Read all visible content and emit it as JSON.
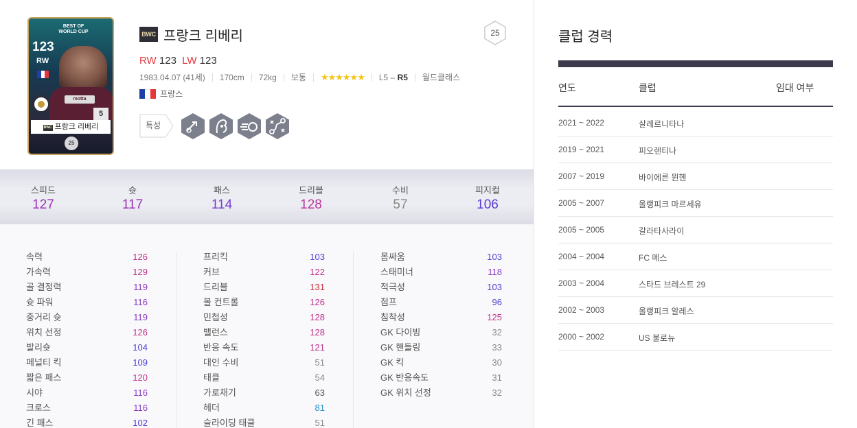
{
  "player": {
    "card": {
      "edition_label": "BEST OF WORLD CUP",
      "ovr": "123",
      "pos": "RW",
      "shirt_text": "motta",
      "reinforce": "5",
      "name": "프랑크 리베리",
      "name_badge": "BWC",
      "level": "25"
    },
    "season_badge": "BWC",
    "name": "프랑크 리베리",
    "level": "25",
    "positions": [
      {
        "pos": "RW",
        "ovr": "123"
      },
      {
        "pos": "LW",
        "ovr": "123"
      }
    ],
    "meta": {
      "birth": "1983.04.07 (41세)",
      "height": "170cm",
      "weight": "72kg",
      "body": "보통",
      "stars": "★★★★★★",
      "foot_prefix": "L5 – ",
      "foot_strong": "R5",
      "reputation": "월드클래스"
    },
    "nation": "프랑스",
    "trait_label": "특성",
    "trait_icons": [
      "long-shot-icon",
      "technical-dribbler-icon",
      "speed-dribbler-icon",
      "playmaker-icon"
    ],
    "colors": {
      "pos_red": "#e0383e",
      "stars": "#f5c518",
      "flag_blue": "#1f3fa8",
      "flag_red": "#e8353a",
      "dark_bar": "#3d3a4d"
    }
  },
  "summary": [
    {
      "label": "스피드",
      "value": "127",
      "color": "#9b2fb8"
    },
    {
      "label": "슛",
      "value": "117",
      "color": "#9b2fb8"
    },
    {
      "label": "패스",
      "value": "114",
      "color": "#7a3ad6"
    },
    {
      "label": "드리블",
      "value": "128",
      "color": "#b8359c"
    },
    {
      "label": "수비",
      "value": "57",
      "color": "#888888"
    },
    {
      "label": "피지컬",
      "value": "106",
      "color": "#5b3ad6"
    }
  ],
  "stats_col1": [
    {
      "label": "속력",
      "value": "126",
      "cls": "c-magenta"
    },
    {
      "label": "가속력",
      "value": "129",
      "cls": "c-magenta"
    },
    {
      "label": "골 결정력",
      "value": "119",
      "cls": "c-purple"
    },
    {
      "label": "슛 파워",
      "value": "116",
      "cls": "c-purple"
    },
    {
      "label": "중거리 슛",
      "value": "119",
      "cls": "c-purple"
    },
    {
      "label": "위치 선정",
      "value": "126",
      "cls": "c-magenta"
    },
    {
      "label": "발리슛",
      "value": "104",
      "cls": "c-blue"
    },
    {
      "label": "페널티 킥",
      "value": "109",
      "cls": "c-blue"
    },
    {
      "label": "짧은 패스",
      "value": "120",
      "cls": "c-magenta"
    },
    {
      "label": "시야",
      "value": "116",
      "cls": "c-purple"
    },
    {
      "label": "크로스",
      "value": "116",
      "cls": "c-purple"
    },
    {
      "label": "긴 패스",
      "value": "102",
      "cls": "c-blue"
    }
  ],
  "stats_col2": [
    {
      "label": "프리킥",
      "value": "103",
      "cls": "c-blue"
    },
    {
      "label": "커브",
      "value": "122",
      "cls": "c-magenta"
    },
    {
      "label": "드리블",
      "value": "131",
      "cls": "c-red"
    },
    {
      "label": "볼 컨트롤",
      "value": "126",
      "cls": "c-magenta"
    },
    {
      "label": "민첩성",
      "value": "128",
      "cls": "c-magenta"
    },
    {
      "label": "밸런스",
      "value": "128",
      "cls": "c-magenta"
    },
    {
      "label": "반응 속도",
      "value": "121",
      "cls": "c-magenta"
    },
    {
      "label": "대인 수비",
      "value": "51",
      "cls": "c-gray"
    },
    {
      "label": "태클",
      "value": "54",
      "cls": "c-gray"
    },
    {
      "label": "가로채기",
      "value": "63",
      "cls": "c-dark"
    },
    {
      "label": "헤더",
      "value": "81",
      "cls": "c-teal"
    },
    {
      "label": "슬라이딩 태클",
      "value": "51",
      "cls": "c-gray"
    }
  ],
  "stats_col3": [
    {
      "label": "몸싸움",
      "value": "103",
      "cls": "c-blue"
    },
    {
      "label": "스태미너",
      "value": "118",
      "cls": "c-purple"
    },
    {
      "label": "적극성",
      "value": "103",
      "cls": "c-blue"
    },
    {
      "label": "점프",
      "value": "96",
      "cls": "c-blue"
    },
    {
      "label": "침착성",
      "value": "125",
      "cls": "c-magenta"
    },
    {
      "label": "GK 다이빙",
      "value": "32",
      "cls": "c-gray"
    },
    {
      "label": "GK 핸들링",
      "value": "33",
      "cls": "c-gray"
    },
    {
      "label": "GK 킥",
      "value": "30",
      "cls": "c-gray"
    },
    {
      "label": "GK 반응속도",
      "value": "31",
      "cls": "c-gray"
    },
    {
      "label": "GK 위치 선정",
      "value": "32",
      "cls": "c-gray"
    }
  ],
  "club_history": {
    "title": "클럽 경력",
    "headers": {
      "year": "연도",
      "club": "클럽",
      "loan": "임대 여부"
    },
    "rows": [
      {
        "year": "2021 ~ 2022",
        "club": "살레르니타나",
        "loan": ""
      },
      {
        "year": "2019 ~ 2021",
        "club": "피오렌티나",
        "loan": ""
      },
      {
        "year": "2007 ~ 2019",
        "club": "바이에른 뮌헨",
        "loan": ""
      },
      {
        "year": "2005 ~ 2007",
        "club": "올랭피크 마르세유",
        "loan": ""
      },
      {
        "year": "2005 ~ 2005",
        "club": "갈라타사라이",
        "loan": ""
      },
      {
        "year": "2004 ~ 2004",
        "club": "FC 메스",
        "loan": ""
      },
      {
        "year": "2003 ~ 2004",
        "club": "스타드 브레스트 29",
        "loan": ""
      },
      {
        "year": "2002 ~ 2003",
        "club": "올랭피크 알레스",
        "loan": ""
      },
      {
        "year": "2000 ~ 2002",
        "club": "US 불로뉴",
        "loan": ""
      }
    ]
  }
}
